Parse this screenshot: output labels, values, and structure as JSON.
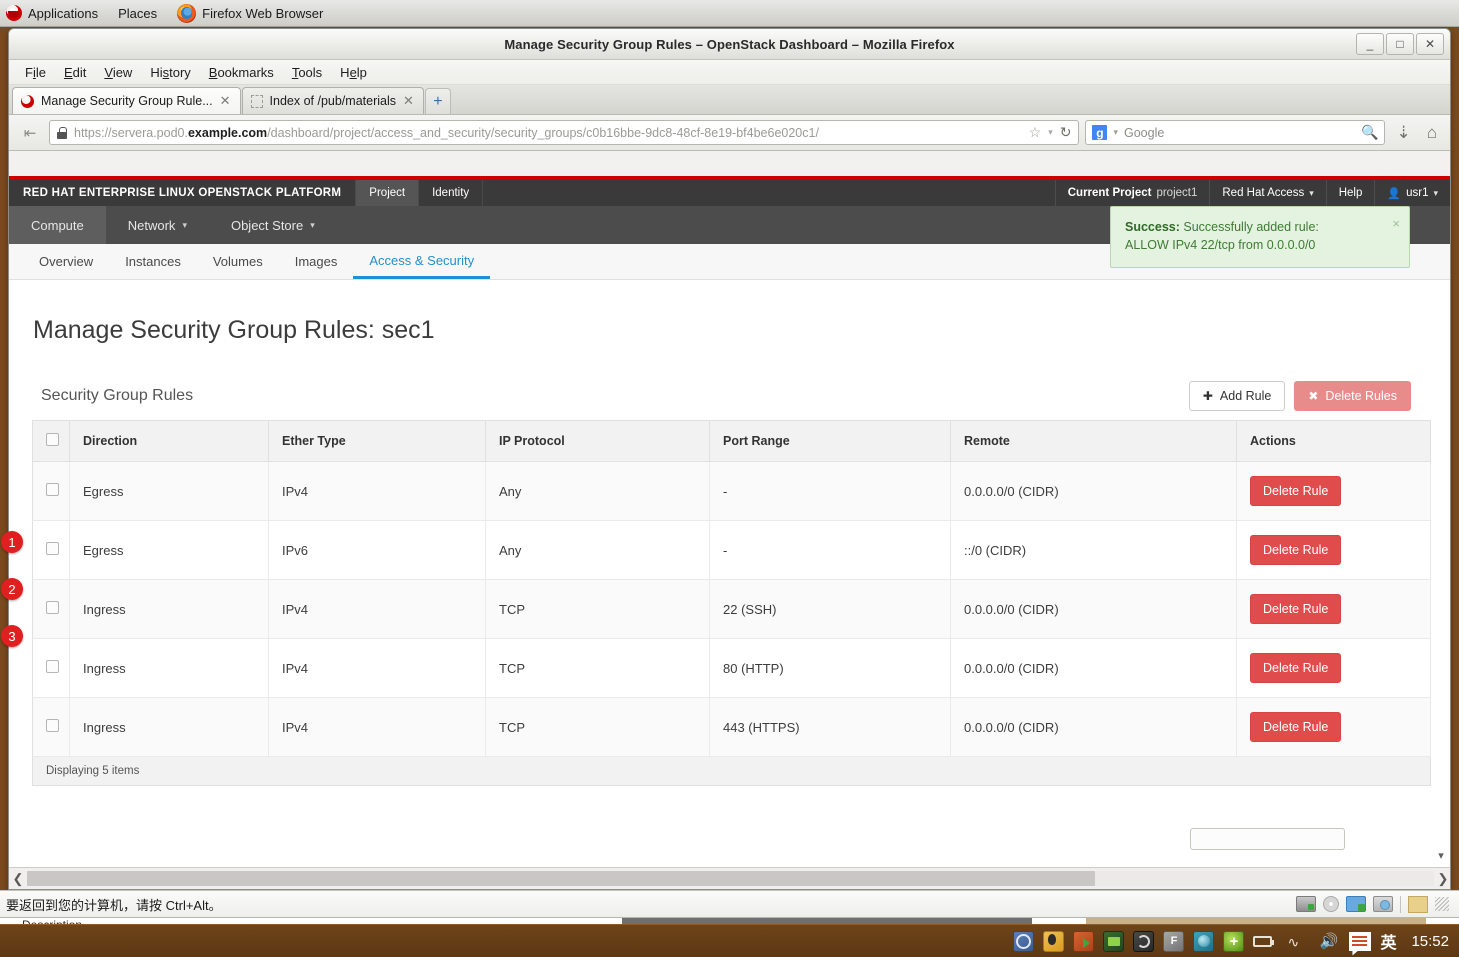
{
  "desktop": {
    "panel": {
      "applications": "Applications",
      "places": "Places",
      "active_window": "Firefox Web Browser"
    },
    "taskbar": {
      "time": "15:52",
      "ime_label": "英",
      "tray_icons": [
        "archive-manager-icon",
        "penguin-qq-icon",
        "share-folder-icon",
        "nvidia-icon",
        "disc-burner-icon",
        "font-manager-icon",
        "network-teal-icon",
        "add-green-icon",
        "battery-icon",
        "wifi-icon",
        "volume-icon",
        "input-method-icon"
      ]
    }
  },
  "browser": {
    "window_title": "Manage Security Group Rules – OpenStack Dashboard – Mozilla Firefox",
    "window_buttons": {
      "minimize": "_",
      "maximize": "□",
      "close": "✕"
    },
    "menus": [
      {
        "pre": "F",
        "key": "i",
        "post": "le"
      },
      {
        "pre": "",
        "key": "E",
        "post": "dit"
      },
      {
        "pre": "",
        "key": "V",
        "post": "iew"
      },
      {
        "pre": "Hi",
        "key": "s",
        "post": "tory"
      },
      {
        "pre": "",
        "key": "B",
        "post": "ookmarks"
      },
      {
        "pre": "",
        "key": "T",
        "post": "ools"
      },
      {
        "pre": "H",
        "key": "e",
        "post": "lp"
      }
    ],
    "tabs": [
      {
        "title": "Manage Security Group Rule...",
        "active": true,
        "favicon": "redhat-favicon",
        "close": "✕"
      },
      {
        "title": "Index of /pub/materials",
        "active": false,
        "favicon": "blank-favicon",
        "close": "✕"
      }
    ],
    "new_tab_label": "+",
    "url": {
      "scheme": "https://",
      "subdomain": "servera.pod0.",
      "domain": "example.com",
      "path": "/dashboard/project/access_and_security/security_groups/c0b16bbe-9dc8-48cf-8e19-bf4be6e020c1/",
      "full": "https://servera.pod0.example.com/dashboard/project/access_and_security/security_groups/c0b16bbe-9dc8-48cf-8e19-bf4be6e020c1/"
    },
    "search": {
      "engine": "Google",
      "placeholder": "Google"
    }
  },
  "openstack": {
    "brand": "RED HAT ENTERPRISE LINUX OPENSTACK PLATFORM",
    "brand_trademark": "®",
    "top_nav": [
      {
        "label": "Project",
        "active": true
      },
      {
        "label": "Identity",
        "active": false
      }
    ],
    "top_right": {
      "current_project_label": "Current Project",
      "current_project_value": "project1",
      "red_hat_access": "Red Hat Access",
      "help": "Help",
      "user": "usr1"
    },
    "sub_nav": [
      {
        "label": "Compute",
        "active": true,
        "has_caret": false
      },
      {
        "label": "Network",
        "active": false,
        "has_caret": true
      },
      {
        "label": "Object Store",
        "active": false,
        "has_caret": true
      }
    ],
    "crumbs": [
      {
        "label": "Overview",
        "active": false
      },
      {
        "label": "Instances",
        "active": false
      },
      {
        "label": "Volumes",
        "active": false
      },
      {
        "label": "Images",
        "active": false
      },
      {
        "label": "Access & Security",
        "active": true
      }
    ],
    "alert": {
      "strong": "Success:",
      "line1": " Successfully added rule:",
      "line2": "ALLOW IPv4 22/tcp from 0.0.0.0/0",
      "close": "×",
      "color": "#e4f2e0"
    },
    "page_title": "Manage Security Group Rules: sec1",
    "table": {
      "caption": "Security Group Rules",
      "add_button": "Add Rule",
      "add_icon": "✚",
      "delete_button": "Delete Rules",
      "delete_icon": "✖",
      "columns": [
        "Direction",
        "Ether Type",
        "IP Protocol",
        "Port Range",
        "Remote",
        "Actions"
      ],
      "rows": [
        {
          "badge": "",
          "direction": "Egress",
          "ether_type": "IPv4",
          "ip_protocol": "Any",
          "port_range": "-",
          "remote": "0.0.0.0/0 (CIDR)",
          "action": "Delete Rule"
        },
        {
          "badge": "",
          "direction": "Egress",
          "ether_type": "IPv6",
          "ip_protocol": "Any",
          "port_range": "-",
          "remote": "::/0 (CIDR)",
          "action": "Delete Rule"
        },
        {
          "badge": "1",
          "direction": "Ingress",
          "ether_type": "IPv4",
          "ip_protocol": "TCP",
          "port_range": "22 (SSH)",
          "remote": "0.0.0.0/0 (CIDR)",
          "action": "Delete Rule"
        },
        {
          "badge": "2",
          "direction": "Ingress",
          "ether_type": "IPv4",
          "ip_protocol": "TCP",
          "port_range": "80 (HTTP)",
          "remote": "0.0.0.0/0 (CIDR)",
          "action": "Delete Rule"
        },
        {
          "badge": "3",
          "direction": "Ingress",
          "ether_type": "IPv4",
          "ip_protocol": "TCP",
          "port_range": "443 (HTTPS)",
          "remote": "0.0.0.0/0 (CIDR)",
          "action": "Delete Rule"
        }
      ],
      "footer": "Displaying 5 items"
    }
  },
  "vm_status": {
    "message": "要返回到您的计算机，请按 Ctrl+Alt。"
  },
  "colors": {
    "redhat_red": "#cc0000",
    "link_blue": "#1f90d4",
    "danger_red": "#e04b4b",
    "success_green": "#3f7b34"
  }
}
